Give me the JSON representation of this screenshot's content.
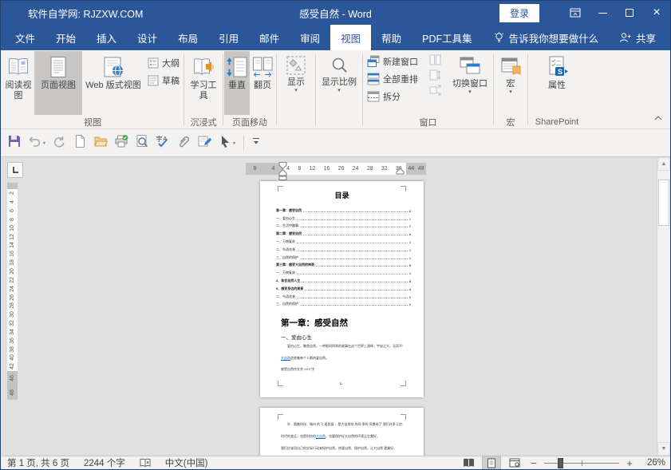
{
  "window": {
    "brand": "软件自学网: RJZXW.COM",
    "title": "感受自然 - Word",
    "login": "登录"
  },
  "tabs": {
    "items": [
      {
        "id": "file",
        "label": "文件"
      },
      {
        "id": "home",
        "label": "开始"
      },
      {
        "id": "insert",
        "label": "插入"
      },
      {
        "id": "design",
        "label": "设计"
      },
      {
        "id": "layout",
        "label": "布局"
      },
      {
        "id": "references",
        "label": "引用"
      },
      {
        "id": "mailings",
        "label": "邮件"
      },
      {
        "id": "review",
        "label": "审阅"
      },
      {
        "id": "view",
        "label": "视图",
        "active": true
      },
      {
        "id": "help",
        "label": "帮助"
      },
      {
        "id": "pdf-tools",
        "label": "PDF工具集"
      }
    ],
    "tell_me": "告诉我你想要做什么",
    "share": "共享"
  },
  "ribbon": {
    "views": {
      "label": "视图",
      "read_mode": "阅读视图",
      "print_layout": "页面视图",
      "web_layout": "Web 版式视图",
      "outline": "大纲",
      "draft": "草稿"
    },
    "immersive": {
      "label": "沉浸式",
      "learning_tools": "学习工具"
    },
    "page_movement": {
      "label": "页面移动",
      "vertical": "垂直",
      "side_to_side": "翻页"
    },
    "show": {
      "label": "显示"
    },
    "zoom": {
      "label": "显示比例"
    },
    "window": {
      "label": "窗口",
      "new_window": "新建窗口",
      "arrange_all": "全部重排",
      "split": "拆分",
      "switch_windows": "切换窗口"
    },
    "macros": {
      "label": "宏",
      "button": "宏"
    },
    "sharepoint": {
      "label": "SharePoint",
      "properties": "属性"
    }
  },
  "quick_access": {
    "icons": [
      "save",
      "undo",
      "repeat",
      "new-document",
      "open",
      "quick-print",
      "print-preview",
      "spelling",
      "attachment",
      "edit",
      "touch-mode",
      "customize-toolbar"
    ]
  },
  "rulers": {
    "h_left": [
      "8",
      "4"
    ],
    "h_mid": [
      "4",
      "8",
      "12",
      "16",
      "20",
      "24",
      "28",
      "32",
      "36"
    ],
    "h_right": [
      "44",
      "48"
    ],
    "v_mid": [
      "2",
      "4",
      "6",
      "8",
      "10",
      "12",
      "14",
      "16",
      "18",
      "20",
      "22",
      "24",
      "26",
      "28",
      "30",
      "32",
      "34",
      "36",
      "38",
      "40",
      "42"
    ],
    "v_bottom": [
      "46",
      "48"
    ]
  },
  "document": {
    "page1": {
      "toc_title": "目录",
      "toc_entries": [
        {
          "text": "第一章：感受自然",
          "page": "1",
          "bold": true
        },
        {
          "text": "一、爱由心生",
          "page": "1",
          "bold": false
        },
        {
          "text": "二、生活中趣事",
          "page": "2",
          "bold": false
        },
        {
          "text": "第二章：感受自然",
          "page": "2",
          "bold": true
        },
        {
          "text": "一、万物复苏",
          "page": "2",
          "bold": false
        },
        {
          "text": "二、鸟语花香",
          "page": "3",
          "bold": false
        },
        {
          "text": "三、自然的保护",
          "page": "3",
          "bold": false
        },
        {
          "text": "第三章：感受大自然的神奇",
          "page": "3",
          "bold": true
        },
        {
          "text": "一、万物复苏",
          "page": "4",
          "bold": false
        },
        {
          "text": "4、体会自然人生",
          "page": "4",
          "bold": true
        },
        {
          "text": "5、感受身边的美景",
          "page": "4",
          "bold": true
        },
        {
          "text": "二、鸟语花香",
          "page": "5",
          "bold": false
        },
        {
          "text": "三、自然的保护",
          "page": "5",
          "bold": false
        }
      ],
      "heading": "第一章：感受自然",
      "subheading": "一、爱由心生",
      "body": [
        [
          {
            "text": "爱由心生，敬畏自然，一转眼间四季的故事在这个世界上演绎，宇宙之大，无奇不有，"
          }
        ],
        [
          {
            "text": "大自然",
            "link": true
          },
          {
            "text": "造就着每个人都热爱自然。"
          }
        ],
        [
          {
            "text": "感受自然作文共 XXX 字"
          }
        ]
      ]
    },
    "page2": {
      "body": [
        [
          {
            "text": "外、随着科技、城市 的飞 速发展 ，是大自然给 的四 季的 风景给了 我们许多 记忆"
          }
        ],
        [
          {
            "text": "时代的变迁，也是科技的"
          },
          {
            "text": "大自然",
            "link": true
          },
          {
            "text": "，也要保护好大自然的环境让它美好。"
          }
        ],
        [
          {
            "text": "我们应该用自己的实际行动来保护自然，热爱自然、保护自然，让大自然 更美好。"
          }
        ]
      ]
    }
  },
  "status_bar": {
    "page_info": "第 1 页, 共 6 页",
    "word_count": "2244 个字",
    "language": "中文(中国)",
    "zoom_level": "26%"
  },
  "colors": {
    "accent": "#2b579a",
    "selected_bg": "#c8c6c4",
    "link": "#0563c1",
    "orange": "#e8912d"
  }
}
